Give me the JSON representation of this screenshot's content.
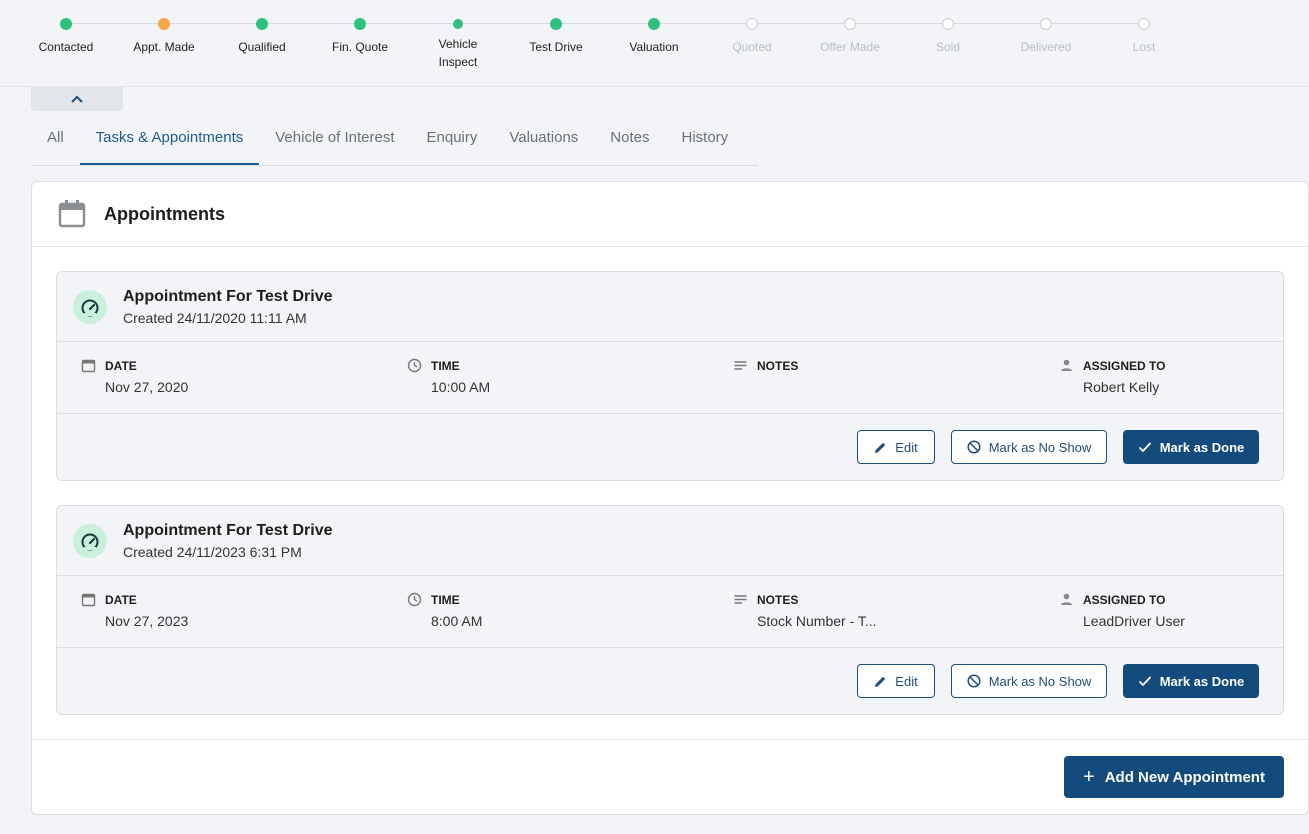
{
  "stepper": {
    "steps": [
      {
        "label": "Contacted",
        "state": "done"
      },
      {
        "label": "Appt. Made",
        "state": "current"
      },
      {
        "label": "Qualified",
        "state": "done"
      },
      {
        "label": "Fin. Quote",
        "state": "done"
      },
      {
        "label_line1": "Vehicle",
        "label_line2": "Inspect",
        "state": "done"
      },
      {
        "label": "Test Drive",
        "state": "done"
      },
      {
        "label": "Valuation",
        "state": "done"
      },
      {
        "label": "Quoted",
        "state": "todo"
      },
      {
        "label": "Offer Made",
        "state": "todo"
      },
      {
        "label": "Sold",
        "state": "todo"
      },
      {
        "label": "Delivered",
        "state": "todo"
      },
      {
        "label": "Lost",
        "state": "todo"
      }
    ]
  },
  "tabs": [
    {
      "label": "All"
    },
    {
      "label": "Tasks & Appointments",
      "active": true
    },
    {
      "label": "Vehicle of Interest"
    },
    {
      "label": "Enquiry"
    },
    {
      "label": "Valuations"
    },
    {
      "label": "Notes"
    },
    {
      "label": "History"
    }
  ],
  "panel": {
    "title": "Appointments",
    "add_button": "Add New Appointment"
  },
  "field_labels": {
    "date": "DATE",
    "time": "TIME",
    "notes": "NOTES",
    "assigned": "ASSIGNED TO"
  },
  "actions": {
    "edit": "Edit",
    "no_show": "Mark as No Show",
    "done": "Mark as Done"
  },
  "appointments": [
    {
      "title": "Appointment For Test Drive",
      "created": "Created 24/11/2020 11:11 AM",
      "date": "Nov 27, 2020",
      "time": "10:00 AM",
      "notes": "",
      "assigned": "Robert Kelly"
    },
    {
      "title": "Appointment For Test Drive",
      "created": "Created 24/11/2023 6:31 PM",
      "date": "Nov 27, 2023",
      "time": "8:00 AM",
      "notes": "Stock Number - T...",
      "assigned": "LeadDriver User"
    }
  ],
  "colors": {
    "primary": "#124b7c",
    "step_done": "#2ec27e",
    "step_current": "#f5a74a",
    "icon_bg": "#c9f0dc"
  }
}
